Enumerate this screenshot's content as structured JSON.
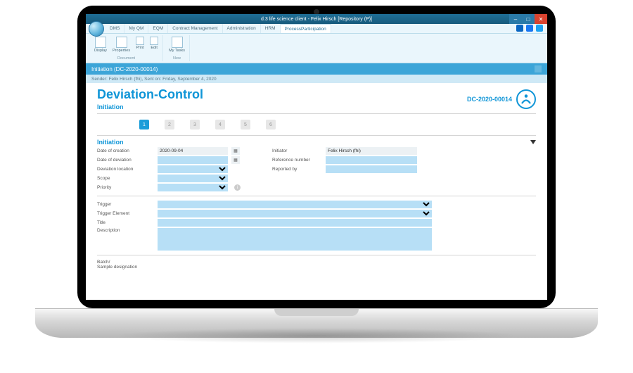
{
  "window": {
    "title": "d.3 life science client - Felix Hirsch [Repository (P)]"
  },
  "tabs": [
    "DMS",
    "My QM",
    "EQM",
    "Contract Management",
    "Administration",
    "HRM",
    "ProcessParticipation"
  ],
  "active_tab": 6,
  "ribbon": {
    "group1_title": "Document",
    "group2_title": "New",
    "buttons": {
      "display": "Display",
      "properties": "Properties",
      "print": "Print",
      "edit": "Edit",
      "mytasks": "My Tasks"
    }
  },
  "bar": {
    "title": "Initiation (DC-2020-00014)"
  },
  "bar2": {
    "text": "Sender: Felix Hirsch (fhi), Sent on: Friday, September 4, 2020"
  },
  "doc": {
    "title": "Deviation-Control",
    "subtitle": "Initiation",
    "id": "DC-2020-00014",
    "section": "Initiation",
    "steps": [
      "1",
      "2",
      "3",
      "4",
      "5",
      "6"
    ],
    "active_step": 0,
    "fields": {
      "date_of_creation_label": "Date of creation",
      "date_of_creation": "2020-09-04",
      "initiator_label": "Initiator",
      "initiator": "Felix Hirsch (fhi)",
      "date_of_deviation_label": "Date of deviation",
      "reference_label": "Reference number",
      "deviation_location_label": "Deviation location",
      "reported_by_label": "Reported by",
      "scope_label": "Scope",
      "priority_label": "Priority",
      "trigger_label": "Trigger",
      "trigger_element_label": "Trigger Element",
      "title_label": "Title",
      "description_label": "Description",
      "batch_label": "Batch/\nSample designation"
    }
  }
}
